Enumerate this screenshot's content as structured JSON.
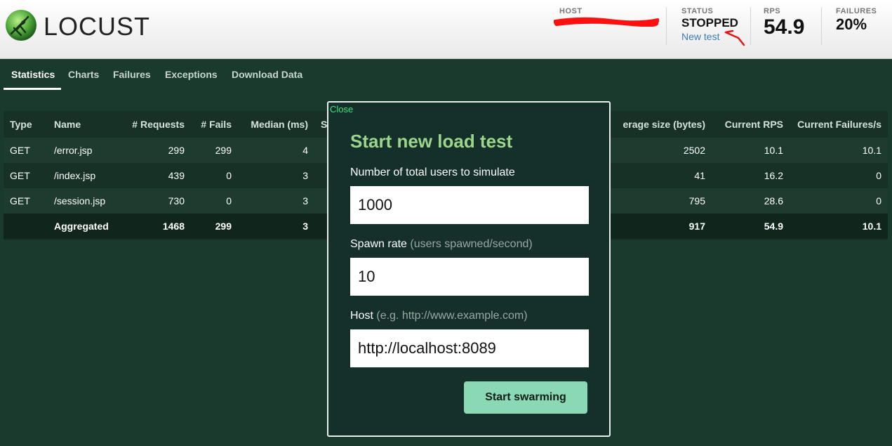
{
  "header": {
    "logo_text": "LOCUST",
    "host": {
      "label": "HOST",
      "value": ""
    },
    "status": {
      "label": "STATUS",
      "value": "STOPPED",
      "link": "New test"
    },
    "rps": {
      "label": "RPS",
      "value": "54.9"
    },
    "failures": {
      "label": "FAILURES",
      "value": "20%"
    }
  },
  "tabs": [
    {
      "label": "Statistics",
      "active": true
    },
    {
      "label": "Charts"
    },
    {
      "label": "Failures"
    },
    {
      "label": "Exceptions"
    },
    {
      "label": "Download Data"
    }
  ],
  "table": {
    "columns": [
      "Type",
      "Name",
      "# Requests",
      "# Fails",
      "Median (ms)",
      "S",
      "erage size (bytes)",
      "Current RPS",
      "Current Failures/s"
    ],
    "rows": [
      {
        "type": "GET",
        "name": "/error.jsp",
        "requests": "299",
        "fails": "299",
        "median": "4",
        "avg_size": "2502",
        "rps": "10.1",
        "failures_s": "10.1"
      },
      {
        "type": "GET",
        "name": "/index.jsp",
        "requests": "439",
        "fails": "0",
        "median": "3",
        "avg_size": "41",
        "rps": "16.2",
        "failures_s": "0"
      },
      {
        "type": "GET",
        "name": "/session.jsp",
        "requests": "730",
        "fails": "0",
        "median": "3",
        "avg_size": "795",
        "rps": "28.6",
        "failures_s": "0"
      }
    ],
    "aggregated": {
      "name": "Aggregated",
      "requests": "1468",
      "fails": "299",
      "median": "3",
      "avg_size": "917",
      "rps": "54.9",
      "failures_s": "10.1"
    }
  },
  "modal": {
    "close": "Close",
    "title": "Start new load test",
    "users_label": "Number of total users to simulate",
    "users_value": "1000",
    "spawn_label": "Spawn rate",
    "spawn_hint": "(users spawned/second)",
    "spawn_value": "10",
    "host_label": "Host",
    "host_hint": "(e.g. http://www.example.com)",
    "host_value": "http://localhost:8089",
    "submit": "Start swarming"
  },
  "colors": {
    "background": "#1b3a2e",
    "modal_title": "#9bd68b",
    "button": "#8bd8b4",
    "close_link": "#3fe07f",
    "link": "#3d7bb3"
  }
}
